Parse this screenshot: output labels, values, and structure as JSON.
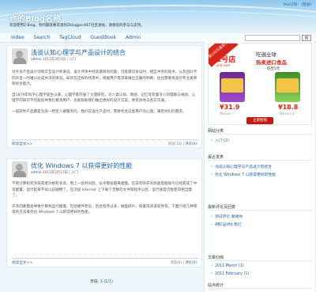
{
  "site": {
    "title": "你的Blog名称",
    "description": "欢迎使用Z-Blog，有问题就要去请到Zblogger.NET社区发帖，谢谢您的参与与支持。",
    "rss_link": "Rss订阅",
    "login_link": "[登录]"
  },
  "nav": [
    "Index",
    "Search",
    "TagCloud",
    "GuestBook",
    "Admin"
  ],
  "search": {
    "button_label": "搜"
  },
  "posts": [
    {
      "title": "浅谈认知心理学与产品设计的结合",
      "author": "admin",
      "date": "2011年3月1日",
      "category": "入门",
      "paragraphs": [
        "对许多产品设计师和交互设计师来说，设计评审中经常遇到的问题，可能遇见争议时、相互冲突的观点、以及团队不同声音一时难以达成共识的情况。如何在这样的场景中，根据用户需求来做出正确的判断，往往需要很高的专业素养和综合能力。",
        "自1879年科学心理学诞生以来，心理学家开展了大量研究，对人类认知、情感、记忆等有着深入的理解与阐述。心理学的知识不仅能指导我们看清用户，也能帮助我们做出更好的设计方案，更有效地与各方沟通。",
        "一般软件产品都是为某一特定人群服务的，我们在设计产品时，需要考虑这类用户的心理，满足他们的需求。"
      ],
      "more": "阅读全文>>",
      "footer_prefix": "浏览(13)",
      "footer_comments": "评论(0)"
    },
    {
      "title": "优化 Windows 7 以获得更好的性能",
      "author": "admin",
      "date": "2011年2月27日",
      "category": "入门",
      "paragraphs": [
        "不管计算机有多快或者价格有多高，用上一段时间后，似乎都会越来越慢。您去年购买的高端电脑如今已经变成了中等配置，运行起来不如以前顺畅了。在浏览 Internet 上下载了无数的文件和程序以后，运行速度可能变得相当慢了。",
        "许多因素都会导致计算机运行缓慢，包括硬件老化、后台程序过多、磁盘碎片、病毒或间谍软件等。下面介绍几种简单的方法来优化 Windows 7 以获得更好的性能。"
      ],
      "more": "阅读全文>>",
      "footer_prefix": "浏览(6)",
      "footer_comments": "评论(0)"
    }
  ],
  "pager": {
    "label": "页码:",
    "current": "1",
    "total_link": "1/1"
  },
  "ad": {
    "badge": "满100元直返5元",
    "logo": "1号店",
    "logo_sub": "yhd.com",
    "headline1": "吃遍全球",
    "headline2": "热卖进口食品",
    "headline3": "低至5元",
    "price1": "¥31.9",
    "orig1": "原价¥49",
    "price2": "¥18.8",
    "orig2": "原价¥24.8",
    "button": "立即抢购"
  },
  "sidebar": {
    "categories_title": "网站分类",
    "categories": [
      "入门 (2)"
    ],
    "recent_title": "最近发表",
    "recent": [
      "浅谈认知心理学与产品设计的结合",
      "优化 Windows 7 以获得更好的性能"
    ],
    "comments_title": "最新评论及回复",
    "comments": [
      "测试评论 谢谢你",
      "ABC@dfd.我们"
    ],
    "archive_title": "文章归档",
    "archive": [
      "2011 March (1)",
      "2011 February (1)"
    ],
    "stats_title": "站点统计"
  }
}
